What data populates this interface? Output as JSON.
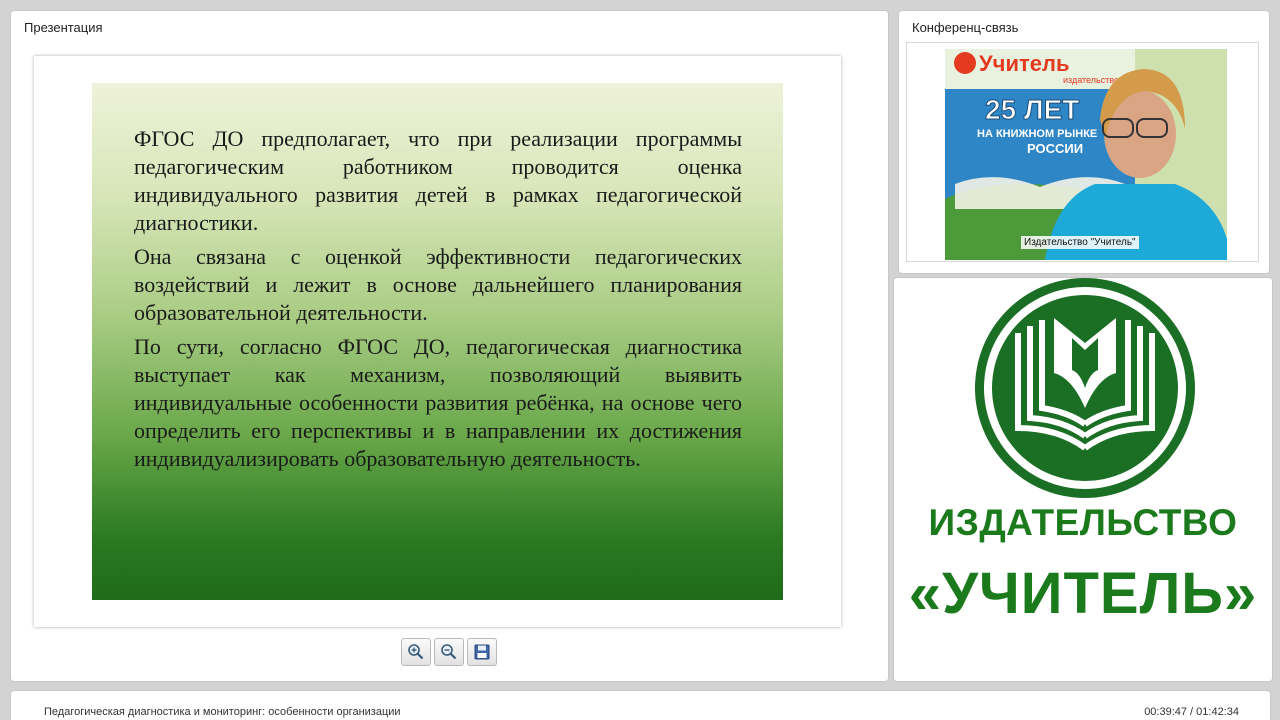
{
  "presentation": {
    "title": "Презентация",
    "slide": {
      "paragraphs": [
        "ФГОС ДО предполагает, что при реализации программы педагогическим работником проводится оценка индивидуального развития детей в рамках педагогической диагностики.",
        "Она связана с оценкой эффективности педагогических воздействий и лежит в основе дальнейшего планирования образовательной деятельности.",
        "По сути, согласно ФГОС ДО, педагогическая диагностика выступает как механизм, позволяющий выявить индивидуальные особенности развития ребёнка, на основе чего определить его перспективы и в направлении их достижения индивидуализировать образовательную деятельность."
      ]
    },
    "toolbar": {
      "zoom_in_icon": "zoom-in-icon",
      "zoom_out_icon": "zoom-out-icon",
      "save_icon": "save-icon"
    }
  },
  "conference": {
    "title": "Конференц-связь",
    "video_caption": "Издательство \"Учитель\"",
    "banner_top": "Учитель",
    "banner_sub": "издательство",
    "banner_years": "25 ЛЕТ",
    "banner_line1": "НА КНИЖНОМ РЫНКЕ",
    "banner_line2": "РОССИИ"
  },
  "logo": {
    "line1": "ИЗДАТЕЛЬСТВО",
    "line2": "«УЧИТЕЛЬ»",
    "color": "#1b7a1b"
  },
  "footer": {
    "title": "Педагогическая диагностика и мониторинг: особенности организации",
    "time": "00:39:47 / 01:42:34"
  }
}
